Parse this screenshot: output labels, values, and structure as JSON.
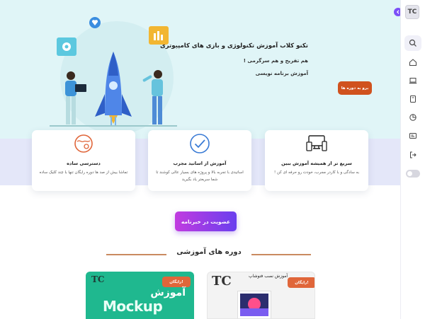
{
  "sidebar": {
    "logo_text": "TC",
    "items": [
      {
        "icon": "search-icon"
      },
      {
        "icon": "home-icon"
      },
      {
        "icon": "laptop-icon"
      },
      {
        "icon": "book-icon"
      },
      {
        "icon": "pie-chart-icon"
      },
      {
        "icon": "id-card-icon"
      },
      {
        "icon": "logout-icon"
      }
    ],
    "theme_toggle": "off"
  },
  "hero": {
    "title": "تکنو کلاب آموزش تکنولوژی و بازی های کامپیوتری",
    "subtitle": "هم تفریح و هم سرگرمی !",
    "tagline": "آموزش برنامه نویسی",
    "cta_label": "برو به دوره ها"
  },
  "features": [
    {
      "title": "سریع تر از همیشه آموزش ببین",
      "desc": "به سادگی و با کاردر مجرب، خودت رو حرفه ای کن !",
      "icon": "devices-icon"
    },
    {
      "title": "آموزش از اساتید مجرب",
      "desc": "اساتیدی با تجربه بالا و پروژه های بسیار عالی کوشند تا شما سریعتر یاد بگیرید",
      "icon": "check-circle-icon"
    },
    {
      "title": "دسترسی ساده",
      "desc": "تماشا بیش از صد ها دوره رایگان تنها با چند کلیک ساده",
      "icon": "globe-location-icon"
    }
  ],
  "newsletter_button": "عضویت در خبرنامه",
  "section_title": "دوره های آموزشی",
  "courses": [
    {
      "badge": "رایگان!",
      "brand": "TC",
      "label": "آموزش",
      "name": "Mockup"
    },
    {
      "badge": "رایگان!",
      "brand": "TC",
      "title": "آموزش نصب فتوشاپ"
    }
  ],
  "colors": {
    "accent": "#7b4ff7",
    "cta": "#d0521e",
    "hero_bg": "#e0f5f7",
    "course_green": "#1fb88f"
  }
}
